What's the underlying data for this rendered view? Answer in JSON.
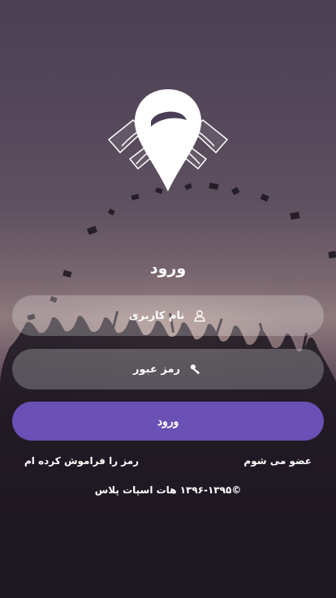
{
  "login": {
    "title": "ورود",
    "username_placeholder": "نام کاربری",
    "password_placeholder": "رمز عبور",
    "submit_label": "ورود",
    "forgot_password": "رمز را فراموش کرده ام",
    "signup": "عضو می شوم",
    "copyright": "©۱۳۹۶-۱۳۹۵ هات اسپات پلاس"
  },
  "icons": {
    "logo": "wifi-location-pin-logo",
    "username": "user-icon",
    "password": "key-icon"
  },
  "colors": {
    "accent": "#6a4fb4",
    "field_bg": "rgba(255,255,255,0.24)",
    "text": "#ffffff"
  }
}
